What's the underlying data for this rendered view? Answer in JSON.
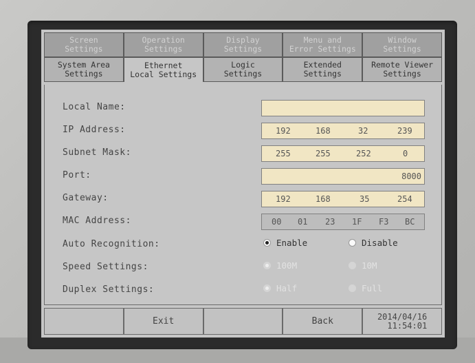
{
  "tabs": {
    "row1": [
      "Screen\nSettings",
      "Operation\nSettings",
      "Display\nSettings",
      "Menu and\nError Settings",
      "Window\nSettings"
    ],
    "row2": [
      "System Area\nSettings",
      "Ethernet\nLocal Settings",
      "Logic\nSettings",
      "Extended\nSettings",
      "Remote Viewer\nSettings"
    ]
  },
  "form": {
    "local_name_label": "Local Name:",
    "local_name_value": "",
    "ip_label": "IP Address:",
    "ip": [
      "192",
      "168",
      "32",
      "239"
    ],
    "subnet_label": "Subnet Mask:",
    "subnet": [
      "255",
      "255",
      "252",
      "0"
    ],
    "port_label": "Port:",
    "port": "8000",
    "gateway_label": "Gateway:",
    "gateway": [
      "192",
      "168",
      "35",
      "254"
    ],
    "mac_label": "MAC Address:",
    "mac": [
      "00",
      "01",
      "23",
      "1F",
      "F3",
      "BC"
    ],
    "auto_label": "Auto Recognition:",
    "auto_enable": "Enable",
    "auto_disable": "Disable",
    "speed_label": "Speed Settings:",
    "speed_100": "100M",
    "speed_10": "10M",
    "duplex_label": "Duplex Settings:",
    "duplex_half": "Half",
    "duplex_full": "Full"
  },
  "footer": {
    "exit": "Exit",
    "back": "Back",
    "datetime": "2014/04/16\n11:54:01"
  }
}
